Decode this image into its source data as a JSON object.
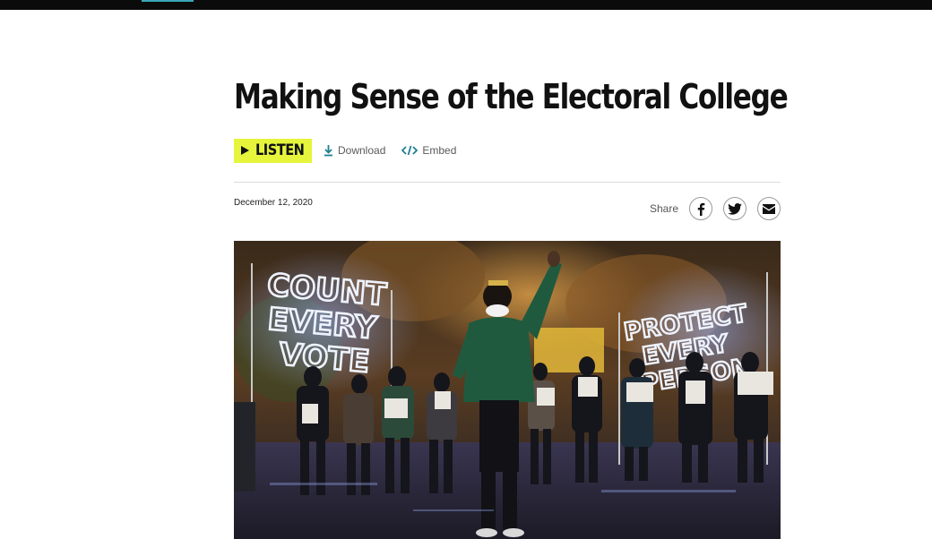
{
  "article": {
    "title": "Making Sense of the Electoral College",
    "date": "December 12, 2020"
  },
  "actions": {
    "listen_label": "LISTEN",
    "download_label": "Download",
    "embed_label": "Embed"
  },
  "share": {
    "label": "Share"
  },
  "photo": {
    "sign_left": [
      "COUNT",
      "EVERY",
      "VOTE"
    ],
    "sign_right": [
      "PROTECT",
      "EVERY",
      "PERSON"
    ]
  },
  "colors": {
    "listen_bg": "#e6f53c",
    "accent": "#1f7f8f",
    "topbar": "#0b0b0b"
  }
}
